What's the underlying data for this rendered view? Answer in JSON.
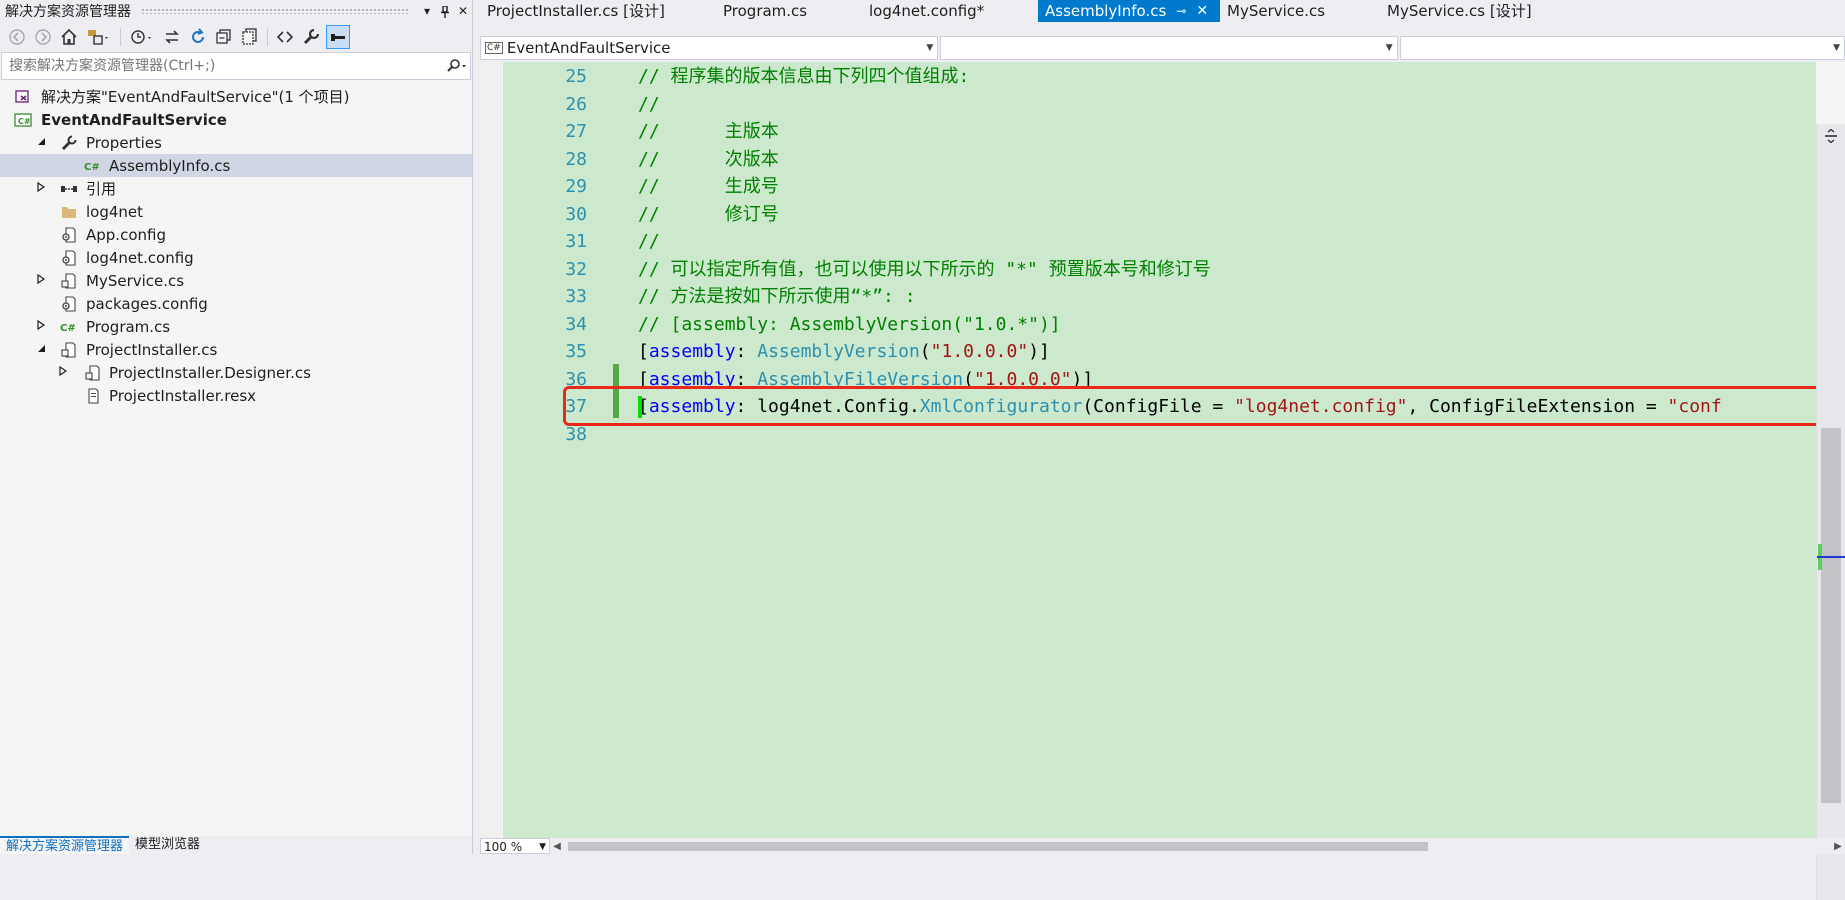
{
  "solution_explorer": {
    "title": "解决方案资源管理器",
    "title_dropdown": "▾",
    "title_pin": "📌",
    "title_close": "✕",
    "search_placeholder": "搜索解决方案资源管理器(Ctrl+;)",
    "tree": [
      {
        "label": "解决方案\"EventAndFaultService\"(1 个项目)",
        "icon": "solution-icon",
        "depth": 0,
        "expander": "none"
      },
      {
        "label": "EventAndFaultService",
        "icon": "csharp-project-icon",
        "depth": 0,
        "expander": "expanded",
        "bold": true
      },
      {
        "label": "Properties",
        "icon": "wrench-icon",
        "depth": 1,
        "expander": "expanded"
      },
      {
        "label": "AssemblyInfo.cs",
        "icon": "csharp-file-icon",
        "depth": 2,
        "expander": "none",
        "selected": true
      },
      {
        "label": "引用",
        "icon": "references-icon",
        "depth": 1,
        "expander": "collapsed"
      },
      {
        "label": "log4net",
        "icon": "folder-icon",
        "depth": 1,
        "expander": "none"
      },
      {
        "label": "App.config",
        "icon": "config-file-icon",
        "depth": 1,
        "expander": "none"
      },
      {
        "label": "log4net.config",
        "icon": "config-file-icon",
        "depth": 1,
        "expander": "none"
      },
      {
        "label": "MyService.cs",
        "icon": "component-file-icon",
        "depth": 1,
        "expander": "collapsed"
      },
      {
        "label": "packages.config",
        "icon": "config-file-icon",
        "depth": 1,
        "expander": "none"
      },
      {
        "label": "Program.cs",
        "icon": "csharp-file-icon",
        "depth": 1,
        "expander": "collapsed"
      },
      {
        "label": "ProjectInstaller.cs",
        "icon": "component-file-icon",
        "depth": 1,
        "expander": "expanded"
      },
      {
        "label": "ProjectInstaller.Designer.cs",
        "icon": "component-file-icon",
        "depth": 2,
        "expander": "collapsed"
      },
      {
        "label": "ProjectInstaller.resx",
        "icon": "resx-file-icon",
        "depth": 2,
        "expander": "none"
      }
    ],
    "bottom_tabs": [
      "解决方案资源管理器",
      "模型浏览器"
    ]
  },
  "editor": {
    "tabs": [
      {
        "label": "ProjectInstaller.cs [设计]",
        "active": false
      },
      {
        "label": "Program.cs",
        "active": false
      },
      {
        "label": "log4net.config*",
        "active": false
      },
      {
        "label": "AssemblyInfo.cs",
        "active": true
      },
      {
        "label": "MyService.cs",
        "active": false
      },
      {
        "label": "MyService.cs [设计]",
        "active": false
      }
    ],
    "active_tab_pin": "⊸",
    "active_tab_close": "✕",
    "nav_project": "EventAndFaultService",
    "nav_type": "",
    "nav_member": "",
    "zoom": "100 %",
    "lines": [
      {
        "num": "25",
        "tokens": [
          {
            "t": "// 程序集的版本信息由下列四个值组成:",
            "c": "comment"
          }
        ]
      },
      {
        "num": "26",
        "tokens": [
          {
            "t": "//",
            "c": "comment"
          }
        ]
      },
      {
        "num": "27",
        "tokens": [
          {
            "t": "//      主版本",
            "c": "comment"
          }
        ]
      },
      {
        "num": "28",
        "tokens": [
          {
            "t": "//      次版本",
            "c": "comment"
          }
        ]
      },
      {
        "num": "29",
        "tokens": [
          {
            "t": "//      生成号",
            "c": "comment"
          }
        ]
      },
      {
        "num": "30",
        "tokens": [
          {
            "t": "//      修订号",
            "c": "comment"
          }
        ]
      },
      {
        "num": "31",
        "tokens": [
          {
            "t": "//",
            "c": "comment"
          }
        ]
      },
      {
        "num": "32",
        "tokens": [
          {
            "t": "// 可以指定所有值，也可以使用以下所示的 \"*\" 预置版本号和修订号",
            "c": "comment"
          }
        ]
      },
      {
        "num": "33",
        "tokens": [
          {
            "t": "// 方法是按如下所示使用“*”: :",
            "c": "comment"
          }
        ]
      },
      {
        "num": "34",
        "tokens": [
          {
            "t": "// [assembly: AssemblyVersion(\"1.0.*\")]",
            "c": "comment"
          }
        ]
      },
      {
        "num": "35",
        "tokens": [
          {
            "t": "[",
            "c": "plain"
          },
          {
            "t": "assembly",
            "c": "kw"
          },
          {
            "t": ": ",
            "c": "plain"
          },
          {
            "t": "AssemblyVersion",
            "c": "type"
          },
          {
            "t": "(",
            "c": "plain"
          },
          {
            "t": "\"1.0.0.0\"",
            "c": "str"
          },
          {
            "t": ")]",
            "c": "plain"
          }
        ]
      },
      {
        "num": "36",
        "tokens": [
          {
            "t": "[",
            "c": "plain"
          },
          {
            "t": "assembly",
            "c": "kw"
          },
          {
            "t": ": ",
            "c": "plain"
          },
          {
            "t": "AssemblyFileVersion",
            "c": "type"
          },
          {
            "t": "(",
            "c": "plain"
          },
          {
            "t": "\"1.0.0.0\"",
            "c": "str"
          },
          {
            "t": ")]",
            "c": "plain"
          }
        ]
      },
      {
        "num": "37",
        "tokens": [
          {
            "t": "[",
            "c": "plain"
          },
          {
            "t": "assembly",
            "c": "kw"
          },
          {
            "t": ": log4net.Config.",
            "c": "plain"
          },
          {
            "t": "XmlConfigurator",
            "c": "type"
          },
          {
            "t": "(ConfigFile = ",
            "c": "plain"
          },
          {
            "t": "\"log4net.config\"",
            "c": "str"
          },
          {
            "t": ", ConfigFileExtension = ",
            "c": "plain"
          },
          {
            "t": "\"conf",
            "c": "str"
          }
        ]
      },
      {
        "num": "38",
        "tokens": []
      }
    ]
  }
}
